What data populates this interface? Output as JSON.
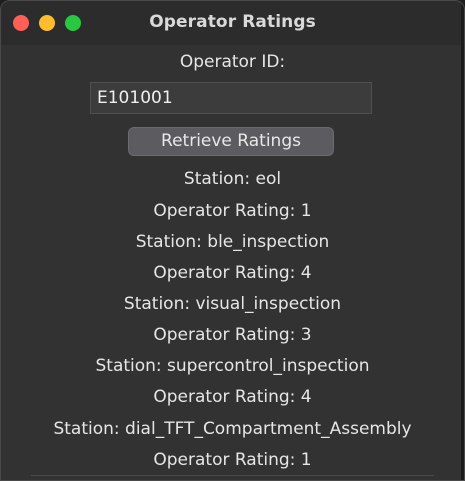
{
  "window": {
    "title": "Operator Ratings"
  },
  "form": {
    "operator_id_label": "Operator ID:",
    "operator_id_value": "E101001",
    "retrieve_button_label": "Retrieve Ratings"
  },
  "results": [
    {
      "station": "Station: eol",
      "rating": "Operator Rating: 1"
    },
    {
      "station": "Station: ble_inspection",
      "rating": "Operator Rating: 4"
    },
    {
      "station": "Station: visual_inspection",
      "rating": "Operator Rating: 3"
    },
    {
      "station": "Station: supercontrol_inspection",
      "rating": "Operator Rating: 4"
    },
    {
      "station": "Station: dial_TFT_Compartment_Assembly",
      "rating": "Operator Rating: 1"
    }
  ],
  "colors": {
    "close": "#fe5f57",
    "minimize": "#febc2e",
    "maximize": "#28c840",
    "window_bg": "#323232"
  }
}
